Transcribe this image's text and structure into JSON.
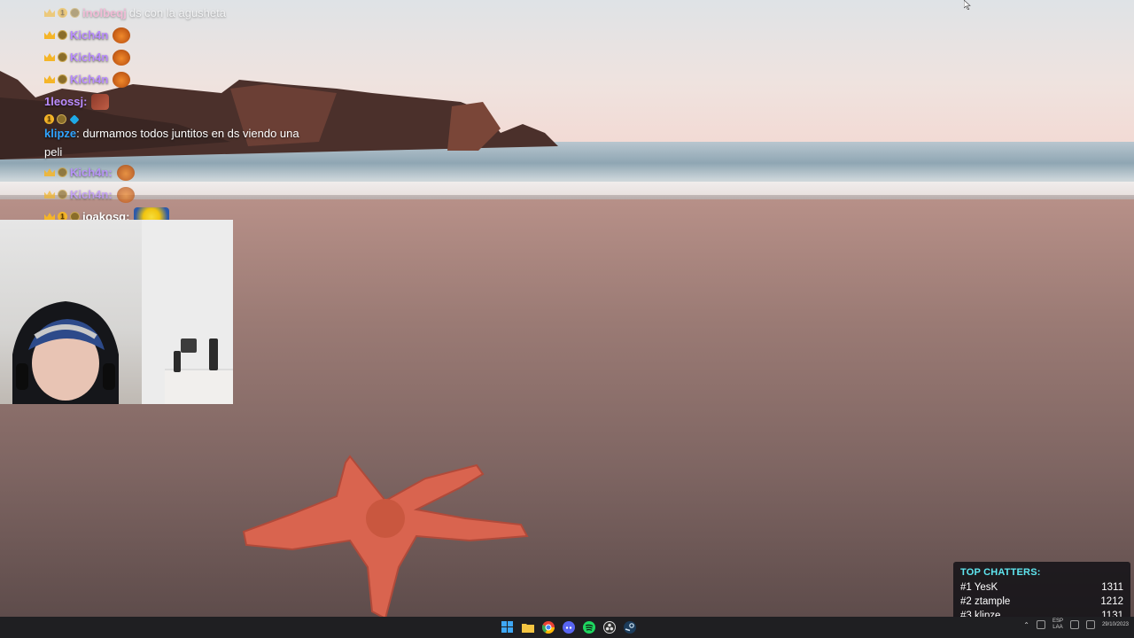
{
  "chat": {
    "messages": [
      {
        "user": "inolbeqj",
        "text": " ds con la agusheta",
        "user_color": "#ff9ecb",
        "faded": true
      },
      {
        "user": "Kich4n",
        "text": "",
        "user_color": "#b98cff"
      },
      {
        "user": "Kich4n",
        "text": "",
        "user_color": "#b98cff"
      },
      {
        "user": "Kich4n",
        "text": "",
        "user_color": "#b98cff"
      },
      {
        "user": "1leossj:",
        "text": "",
        "user_color": "#b98cff"
      },
      {
        "user": "klipze",
        "text": ": durmamos todos juntitos en ds viendo una peli",
        "user_color": "#2fa3ff"
      },
      {
        "user": "Kich4n:",
        "text": "",
        "user_color": "#b98cff"
      },
      {
        "user": "Kich4n:",
        "text": "",
        "user_color": "#b98cff"
      },
      {
        "user": "joakosq:",
        "text": "",
        "user_color": "#ffffff"
      }
    ]
  },
  "top_chatters": {
    "title": "TOP CHATTERS:",
    "rows": [
      {
        "rank": "#1",
        "name": "YesK",
        "count": "1311"
      },
      {
        "rank": "#2",
        "name": "ztample",
        "count": "1212"
      },
      {
        "rank": "#3",
        "name": "klipze",
        "count": "1131"
      }
    ]
  },
  "taskbar": {
    "icons": [
      "windows-start-icon",
      "file-explorer-icon",
      "chrome-icon",
      "discord-icon",
      "spotify-icon",
      "obs-icon",
      "steam-icon"
    ],
    "language_line1": "ESP",
    "language_line2": "LAA",
    "date": "29/10/2023"
  },
  "colors": {
    "accent_cyan": "#5fe7f0",
    "taskbar_bg": "#1f1f22"
  }
}
